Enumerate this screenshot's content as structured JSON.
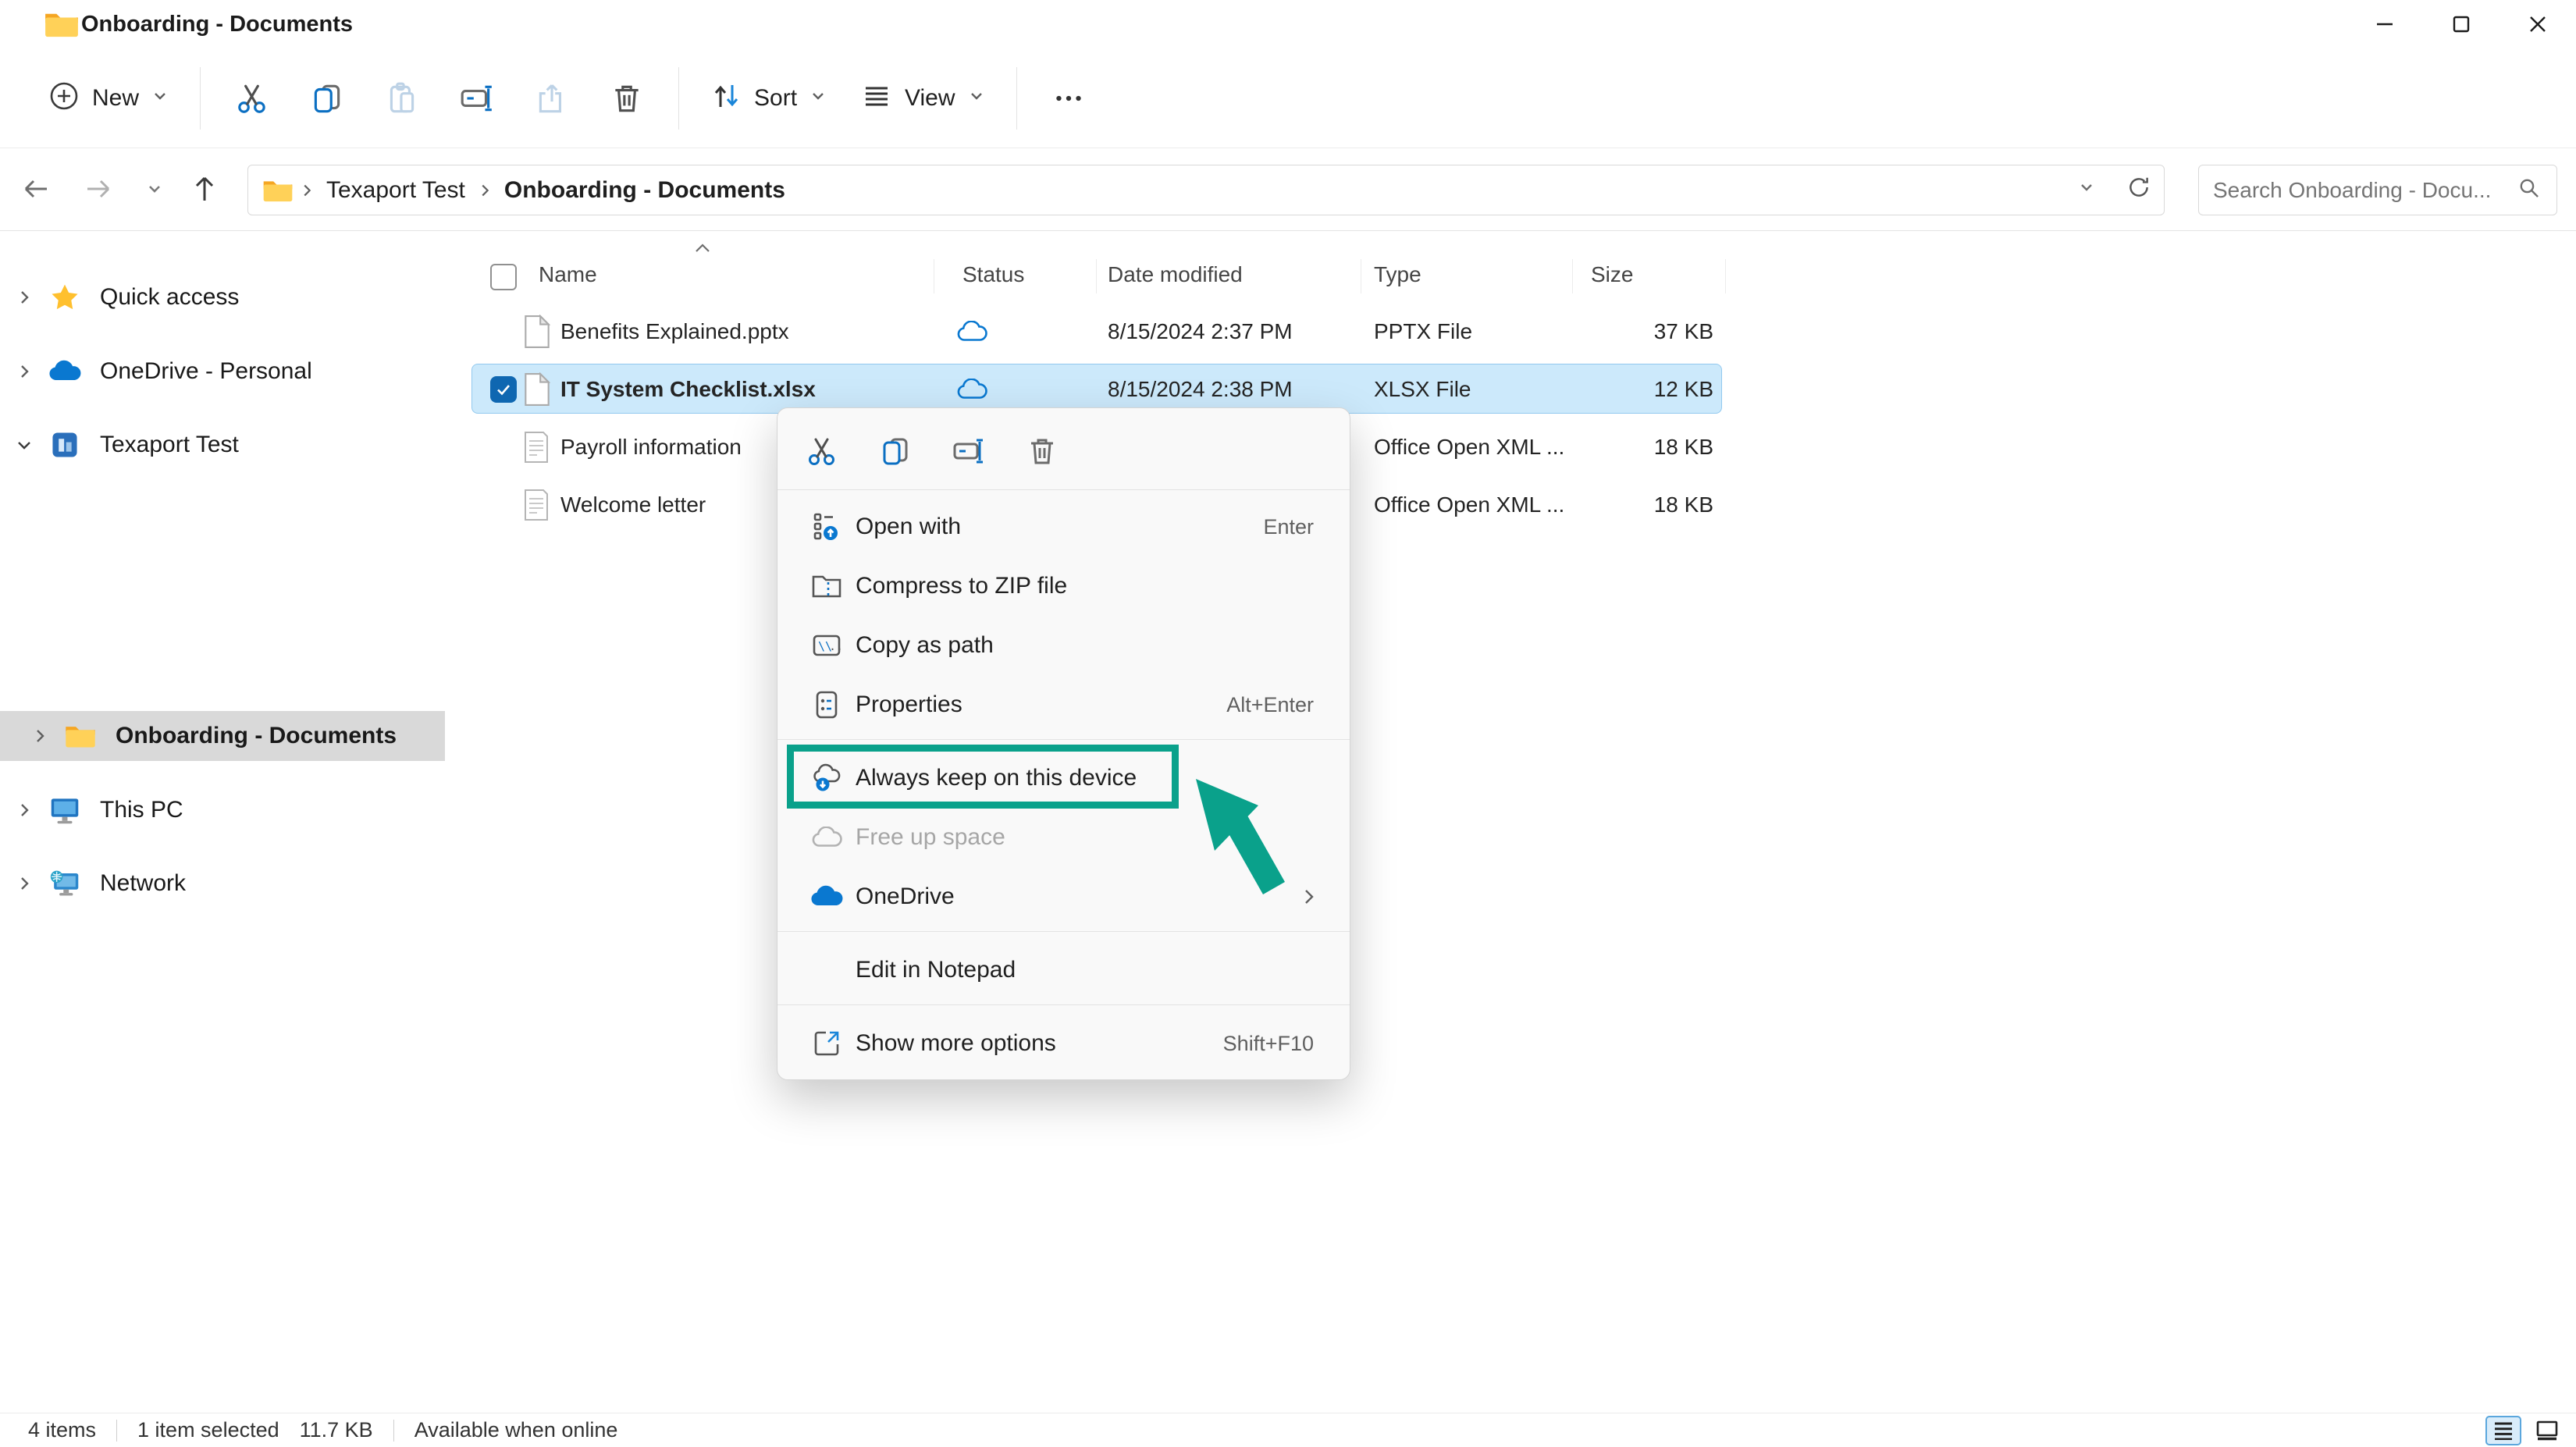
{
  "window": {
    "title": "Onboarding - Documents"
  },
  "toolbar": {
    "new": "New",
    "sort": "Sort",
    "view": "View",
    "more": "•••"
  },
  "addressbar": {
    "breadcrumbs": [
      {
        "label": "Texaport Test"
      },
      {
        "label": "Onboarding - Documents"
      }
    ],
    "search_placeholder": "Search Onboarding - Docu..."
  },
  "sidebar": {
    "items": [
      {
        "label": "Quick access"
      },
      {
        "label": "OneDrive - Personal"
      },
      {
        "label": "Texaport Test"
      },
      {
        "label": "Onboarding - Documents"
      },
      {
        "label": "This PC"
      },
      {
        "label": "Network"
      }
    ]
  },
  "filelist": {
    "columns": {
      "name": "Name",
      "status": "Status",
      "date": "Date modified",
      "type": "Type",
      "size": "Size"
    },
    "rows": [
      {
        "name": "Benefits Explained.pptx",
        "date": "8/15/2024 2:37 PM",
        "type": "PPTX File",
        "size": "37 KB"
      },
      {
        "name": "IT System Checklist.xlsx",
        "date": "8/15/2024 2:38 PM",
        "type": "XLSX File",
        "size": "12 KB"
      },
      {
        "name": "Payroll information",
        "date": "",
        "type": "Office Open XML ...",
        "size": "18 KB"
      },
      {
        "name": "Welcome letter",
        "date": "",
        "type": "Office Open XML ...",
        "size": "18 KB"
      }
    ]
  },
  "context_menu": {
    "open_with": {
      "label": "Open with",
      "shortcut": "Enter"
    },
    "compress": {
      "label": "Compress to ZIP file"
    },
    "copy_as_path": {
      "label": "Copy as path"
    },
    "properties": {
      "label": "Properties",
      "shortcut": "Alt+Enter"
    },
    "always_keep": {
      "label": "Always keep on this device"
    },
    "free_up": {
      "label": "Free up space"
    },
    "onedrive": {
      "label": "OneDrive"
    },
    "edit_notepad": {
      "label": "Edit in Notepad"
    },
    "show_more": {
      "label": "Show more options",
      "shortcut": "Shift+F10"
    }
  },
  "statusbar": {
    "count": "4 items",
    "selection": "1 item selected",
    "selection_size": "11.7 KB",
    "availability": "Available when online"
  },
  "colors": {
    "accent": "#0f67b1",
    "cloud_blue": "#0a78d0",
    "selection_fill": "#cce9fb",
    "selection_border": "#92c9ef",
    "annotation_teal": "#0aa18b"
  }
}
